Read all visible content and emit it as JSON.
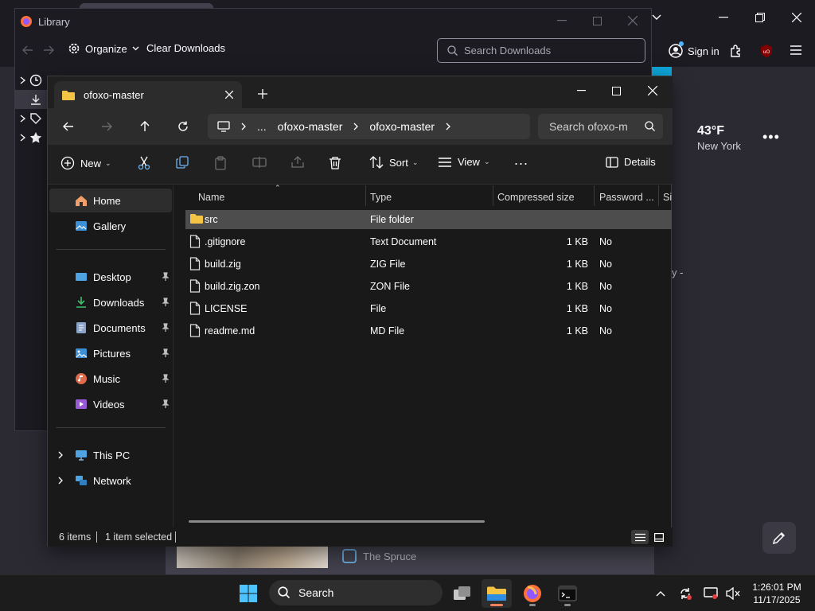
{
  "firefox": {
    "signin_label": "Sign in",
    "weather": {
      "temp": "43°F",
      "city": "New York"
    },
    "stray_text": "y -",
    "news_source": "The Spruce"
  },
  "library": {
    "title": "Library",
    "organize_label": "Organize",
    "clear_label": "Clear Downloads",
    "search_placeholder": "Search Downloads"
  },
  "explorer": {
    "tab_title": "ofoxo-master",
    "breadcrumb": [
      "...",
      "ofoxo-master",
      "ofoxo-master"
    ],
    "search_placeholder": "Search ofoxo-m",
    "commands": {
      "new": "New",
      "sort": "Sort",
      "view": "View",
      "more": "...",
      "details": "Details"
    },
    "nav": {
      "home": "Home",
      "gallery": "Gallery",
      "pinned": [
        "Desktop",
        "Downloads",
        "Documents",
        "Pictures",
        "Music",
        "Videos"
      ],
      "this_pc": "This PC",
      "network": "Network"
    },
    "columns": [
      "Name",
      "Type",
      "Compressed size",
      "Password ...",
      "Si"
    ],
    "files": [
      {
        "name": "src",
        "type": "File folder",
        "size": "",
        "password": "",
        "kind": "folder"
      },
      {
        "name": ".gitignore",
        "type": "Text Document",
        "size": "1 KB",
        "password": "No",
        "kind": "file"
      },
      {
        "name": "build.zig",
        "type": "ZIG File",
        "size": "1 KB",
        "password": "No",
        "kind": "file"
      },
      {
        "name": "build.zig.zon",
        "type": "ZON File",
        "size": "1 KB",
        "password": "No",
        "kind": "file"
      },
      {
        "name": "LICENSE",
        "type": "File",
        "size": "1 KB",
        "password": "No",
        "kind": "file"
      },
      {
        "name": "readme.md",
        "type": "MD File",
        "size": "1 KB",
        "password": "No",
        "kind": "file"
      }
    ],
    "status": {
      "items": "6 items",
      "selected": "1 item selected"
    }
  },
  "taskbar": {
    "search_label": "Search",
    "time": "1:26:01 PM",
    "date": "11/17/2025"
  },
  "colors": {
    "accent_folder": "#f6c445",
    "selection": "#4d4d4d",
    "firefox_accent": "#0ea5d8"
  }
}
